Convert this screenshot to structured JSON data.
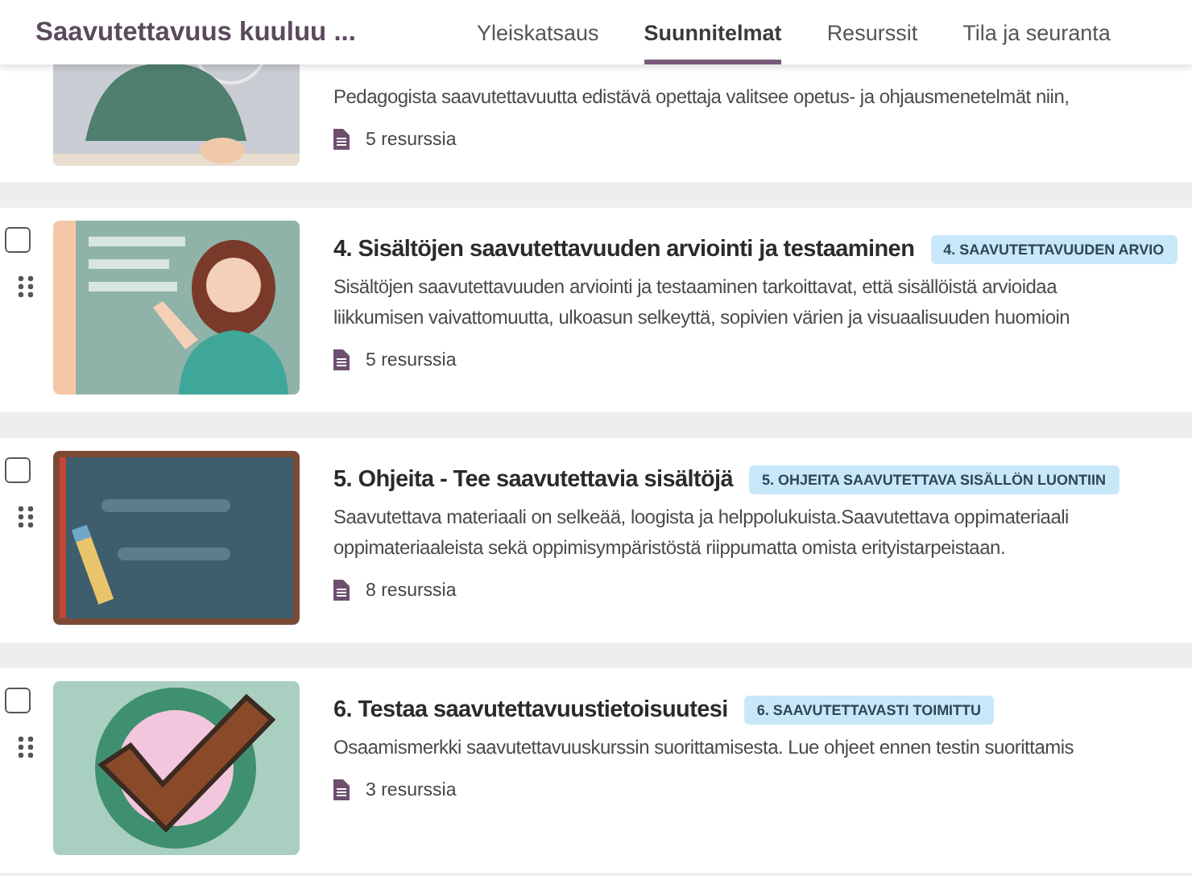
{
  "header": {
    "title": "Saavutettavuus kuuluu ...",
    "tabs": [
      {
        "label": "Yleiskatsaus",
        "selected": false
      },
      {
        "label": "Suunnitelmat",
        "selected": true
      },
      {
        "label": "Resurssit",
        "selected": false
      },
      {
        "label": "Tila ja seuranta",
        "selected": false
      }
    ]
  },
  "plans": [
    {
      "kind": "partial",
      "description_lines": [
        "Pedagogista saavutettavuutta edistävä opettaja valitsee opetus- ja ohjausmenetelmät niin,"
      ],
      "resources": "5 resurssia"
    },
    {
      "kind": "full",
      "checked": false,
      "title": "4. Sisältöjen saavutettavuuden arviointi ja testaaminen",
      "tag": "4. SAAVUTETTAVUUDEN ARVIO",
      "description_lines": [
        "Sisältöjen saavutettavuuden arviointi ja testaaminen tarkoittavat, että sisällöistä arvioidaa",
        "liikkumisen vaivattomuutta, ulkoasun selkeyttä, sopivien värien ja visuaalisuuden huomioin"
      ],
      "resources": "5 resurssia"
    },
    {
      "kind": "full",
      "checked": false,
      "title": "5. Ohjeita - Tee saavutettavia sisältöjä",
      "tag": "5. OHJEITA SAAVUTETTAVA SISÄLLÖN LUONTIIN",
      "description_lines": [
        "Saavutettava materiaali on selkeää, loogista ja helppolukuista.Saavutettava oppimateriaali",
        "oppimateriaaleista sekä oppimisympäristöstä riippumatta omista erityistarpeistaan."
      ],
      "resources": "8 resurssia"
    },
    {
      "kind": "full",
      "checked": false,
      "title": "6. Testaa saavutettavuustietoisuutesi",
      "tag": "6. SAAVUTETTAVASTI TOIMITTU",
      "description_lines": [
        "Osaamismerkki saavutettavuuskurssin suorittamisesta. Lue ohjeet ennen testin suorittamis"
      ],
      "resources": "3 resurssia"
    }
  ]
}
